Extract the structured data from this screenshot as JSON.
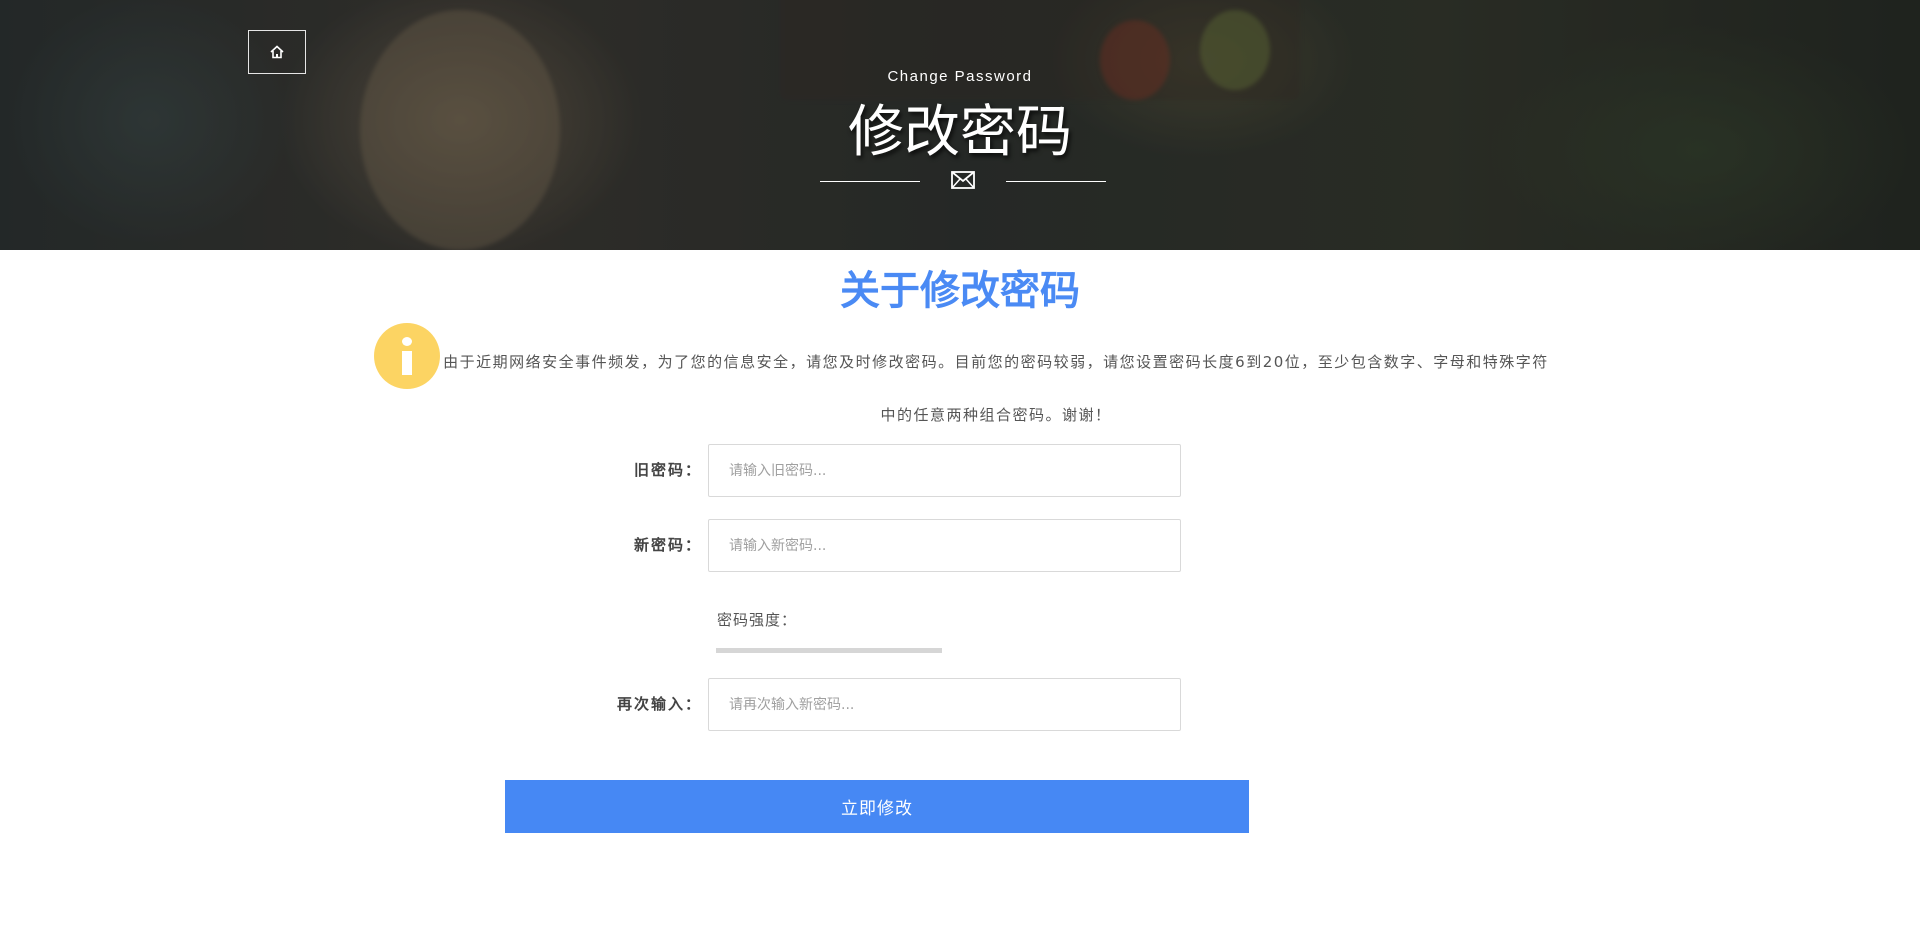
{
  "banner": {
    "subtitle": "Change Password",
    "title": "修改密码",
    "home_icon": "home-icon",
    "divider_icon": "envelope-icon"
  },
  "section": {
    "title": "关于修改密码",
    "info_icon": "info-icon",
    "notice": "由于近期网络安全事件频发，为了您的信息安全，请您及时修改密码。目前您的密码较弱，请您设置密码长度6到20位，至少包含数字、字母和特殊字符中的任意两种组合密码。谢谢！"
  },
  "form": {
    "old_password": {
      "label": "旧密码：",
      "value": "",
      "placeholder": "请输入旧密码..."
    },
    "new_password": {
      "label": "新密码：",
      "value": "",
      "placeholder": "请输入新密码..."
    },
    "strength": {
      "label": "密码强度：",
      "level": 0
    },
    "confirm_password": {
      "label": "再次输入：",
      "value": "",
      "placeholder": "请再次输入新密码..."
    },
    "submit_label": "立即修改"
  },
  "colors": {
    "accent": "#4688f4",
    "title_blue": "#4a8af4",
    "info_yellow": "#fcd463",
    "strength_track": "#d6d6d6"
  }
}
